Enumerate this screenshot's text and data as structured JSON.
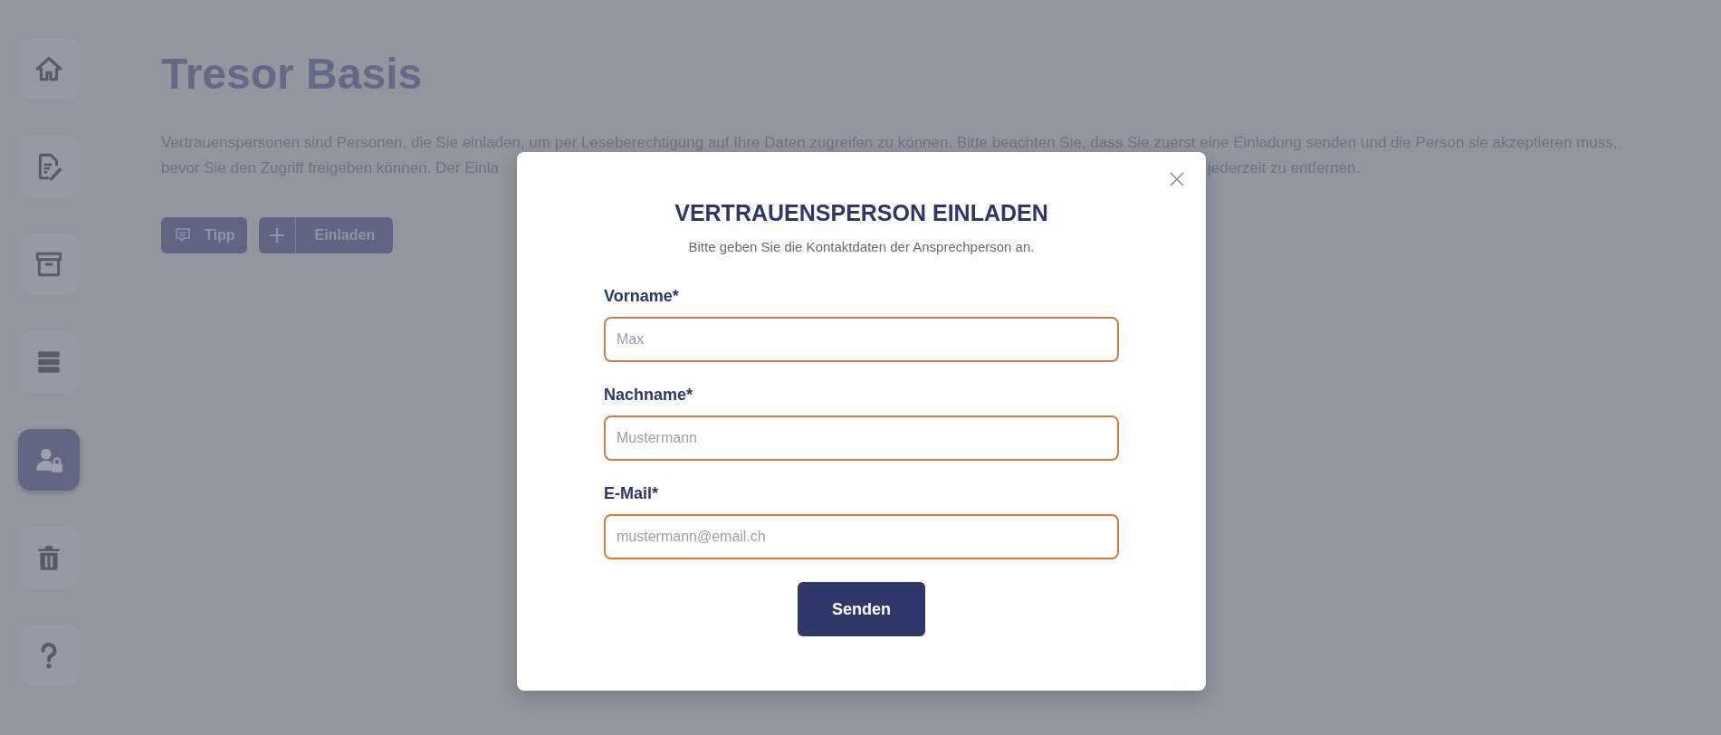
{
  "sidebar": {
    "items": [
      {
        "kind": "home",
        "selected": false
      },
      {
        "kind": "document",
        "selected": false
      },
      {
        "kind": "archive",
        "selected": false
      },
      {
        "kind": "list",
        "selected": false
      },
      {
        "kind": "user-lock",
        "selected": true
      },
      {
        "kind": "trash",
        "selected": false
      },
      {
        "kind": "help",
        "selected": false
      }
    ]
  },
  "page": {
    "title": "Tresor Basis",
    "intro": {
      "line_1": "Vertrauenspersonen sind Personen, die Sie einladen, um per Leseberechtigung auf Ihre Daten zugreifen zu können. Bitte beachten Sie, dass Sie zuerst eine Einladung senden und die Person sie akzeptieren muss,",
      "line_2_start": "bevor Sie den Zugriff freigeben können. Der Einla",
      "line_2_end": "jederzeit zu entfernen."
    },
    "buttons": [
      {
        "kind": "tip",
        "label": "Tipp"
      },
      {
        "kind": "add",
        "label": "Einladen"
      }
    ]
  },
  "modal": {
    "title": "VERTRAUENSPERSON EINLADEN",
    "subtitle": "Bitte geben Sie die Kontaktdaten der Ansprechperson an.",
    "fields": [
      {
        "label": "Vorname*",
        "placeholder": "Max"
      },
      {
        "label": "Nachname*",
        "placeholder": "Mustermann"
      },
      {
        "label": "E-Mail*",
        "placeholder": "mustermann@email.ch"
      }
    ],
    "submit": "Senden"
  }
}
